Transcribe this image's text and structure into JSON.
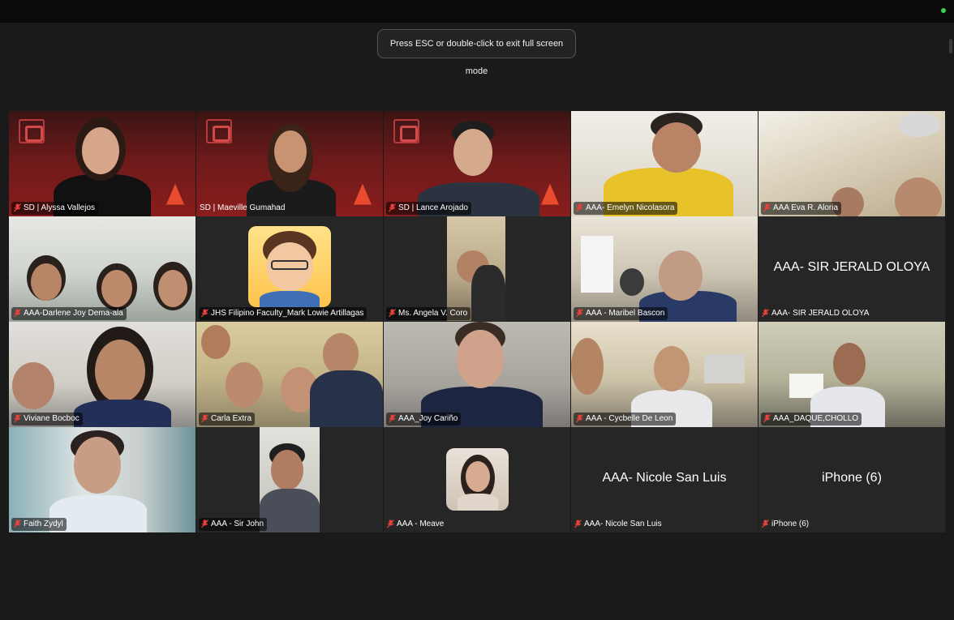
{
  "app": {
    "exit_fullscreen_hint": "Press ESC or double-click to exit full screen mode"
  },
  "colors": {
    "speaking_border": "#4cd964",
    "muted_icon": "#e8403a",
    "background": "#1a1a1a"
  },
  "participants": [
    {
      "name": "SD | Alyssa Vallejos",
      "muted": true,
      "video": "sd-backdrop"
    },
    {
      "name": "SD | Maeville Gumahad",
      "muted": false,
      "video": "sd-backdrop",
      "speaking": true
    },
    {
      "name": "SD | Lance Arojado",
      "muted": true,
      "video": "sd-backdrop"
    },
    {
      "name": "AAA- Emelyn Nicolasora",
      "muted": true,
      "video": "camera"
    },
    {
      "name": "AAA Eva R. Aloria",
      "muted": true,
      "video": "camera"
    },
    {
      "name": "AAA-Darlene Joy Dema-ala",
      "muted": true,
      "video": "camera"
    },
    {
      "name": "JHS Filipino Faculty_Mark Lowie Artillagas",
      "muted": true,
      "video": "avatar"
    },
    {
      "name": "Ms. Angela V. Coro",
      "muted": true,
      "video": "camera-portrait"
    },
    {
      "name": "AAA - Maribel Bascon",
      "muted": true,
      "video": "camera"
    },
    {
      "name": "AAA- SIR JERALD OLOYA",
      "muted": true,
      "video": "off",
      "display_name": "AAA- SIR JERALD OLOYA"
    },
    {
      "name": "Viviane Bocboc",
      "muted": true,
      "video": "camera"
    },
    {
      "name": "Carla Extra",
      "muted": true,
      "video": "camera"
    },
    {
      "name": "AAA_Joy Cariño",
      "muted": true,
      "video": "camera"
    },
    {
      "name": "AAA - Cycbelle De Leon",
      "muted": true,
      "video": "camera"
    },
    {
      "name": "AAA_DAQUE,CHOLLO",
      "muted": true,
      "video": "camera"
    },
    {
      "name": "Faith Zydyl",
      "muted": true,
      "video": "camera"
    },
    {
      "name": "AAA - Sir John",
      "muted": true,
      "video": "camera-portrait"
    },
    {
      "name": "AAA - Meave",
      "muted": true,
      "video": "profile-photo"
    },
    {
      "name": "AAA- Nicole San Luis",
      "muted": true,
      "video": "off",
      "display_name": "AAA- Nicole San Luis"
    },
    {
      "name": "iPhone (6)",
      "muted": true,
      "video": "off",
      "display_name": "iPhone (6)"
    }
  ],
  "icons": {
    "muted": "mic-off-icon"
  }
}
